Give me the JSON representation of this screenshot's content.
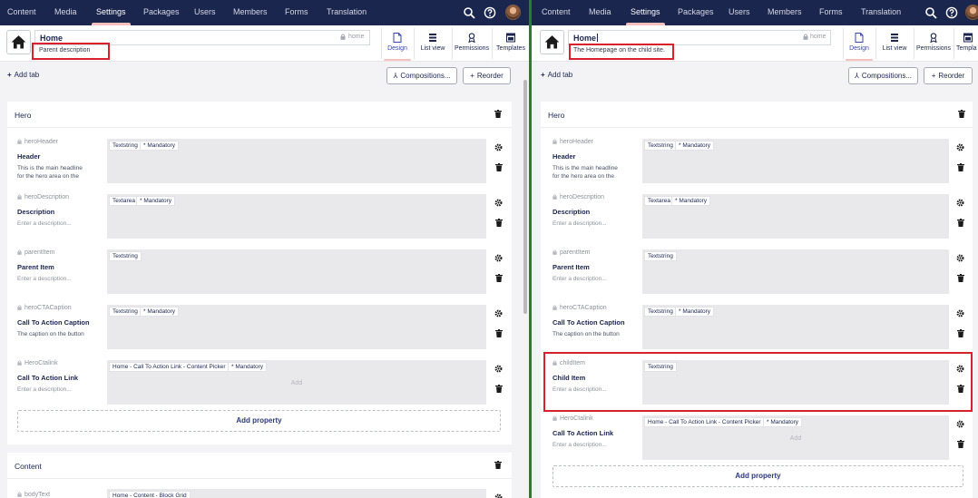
{
  "panes": {
    "left": {
      "nav": [
        "Content",
        "Media",
        "Settings",
        "Packages",
        "Users",
        "Members",
        "Forms",
        "Translation"
      ],
      "doc_name": "Home",
      "alias": "home",
      "description": "Parent description",
      "app_tabs": [
        "Design",
        "List view",
        "Permissions",
        "Templates"
      ],
      "add_tab": "Add tab",
      "compositions": "Compositions...",
      "reorder": "Reorder",
      "groups": [
        {
          "title": "Hero",
          "properties": [
            {
              "alias": "heroHeader",
              "name": "Header",
              "desc": "This is the main headline for the hero area on the",
              "placeholder": false,
              "editor": "Textstring",
              "mandatory": "* Mandatory"
            },
            {
              "alias": "heroDescription",
              "name": "Description",
              "desc": "Enter a description...",
              "placeholder": true,
              "editor": "Textarea",
              "mandatory": "* Mandatory"
            },
            {
              "alias": "parentItem",
              "name": "Parent Item",
              "desc": "Enter a description...",
              "placeholder": true,
              "editor": "Textstring",
              "mandatory": ""
            },
            {
              "alias": "heroCTACaption",
              "name": "Call To Action Caption",
              "desc": "The caption on the button",
              "placeholder": false,
              "editor": "Textstring",
              "mandatory": "* Mandatory"
            },
            {
              "alias": "HeroCtalink",
              "name": "Call To Action Link",
              "desc": "Enter a description...",
              "placeholder": true,
              "editor": "Home - Call To Action Link - Content Picker",
              "mandatory": "* Mandatory",
              "add": "Add"
            }
          ],
          "add_property": "Add property"
        },
        {
          "title": "Content",
          "properties": [
            {
              "alias": "bodyText",
              "editor": "Home - Content - Block Grid"
            }
          ]
        }
      ]
    },
    "right": {
      "nav": [
        "Content",
        "Media",
        "Settings",
        "Packages",
        "Users",
        "Members",
        "Forms",
        "Translation"
      ],
      "doc_name": "Home",
      "alias": "home",
      "description": "The Homepage on the child site.",
      "app_tabs": [
        "Design",
        "List view",
        "Permissions",
        "Templa"
      ],
      "add_tab": "Add tab",
      "compositions": "Compositions...",
      "reorder": "Reorder",
      "groups": [
        {
          "title": "Hero",
          "properties": [
            {
              "alias": "heroHeader",
              "name": "Header",
              "desc": "This is the main headline for the hero area on the",
              "placeholder": false,
              "editor": "Textstring",
              "mandatory": "* Mandatory"
            },
            {
              "alias": "heroDescription",
              "name": "Description",
              "desc": "Enter a description...",
              "placeholder": true,
              "editor": "Textarea",
              "mandatory": "* Mandatory"
            },
            {
              "alias": "parentItem",
              "name": "Parent Item",
              "desc": "Enter a description...",
              "placeholder": true,
              "editor": "Textstring",
              "mandatory": ""
            },
            {
              "alias": "heroCTACaption",
              "name": "Call To Action Caption",
              "desc": "The caption on the button",
              "placeholder": false,
              "editor": "Textstring",
              "mandatory": "* Mandatory"
            },
            {
              "alias": "childItem",
              "name": "Child Item",
              "desc": "Enter a description...",
              "placeholder": true,
              "editor": "Textstring",
              "mandatory": ""
            },
            {
              "alias": "HeroCtalink",
              "name": "Call To Action Link",
              "desc": "Enter a description...",
              "placeholder": true,
              "editor": "Home - Call To Action Link - Content Picker",
              "mandatory": "* Mandatory",
              "add": "Add"
            }
          ],
          "add_property": "Add property"
        }
      ]
    }
  },
  "colors": {
    "nav_bg": "#1b264f",
    "highlight": "#d9202b",
    "divider": "#2d7a34",
    "active_tab": "#f5c1bc"
  }
}
